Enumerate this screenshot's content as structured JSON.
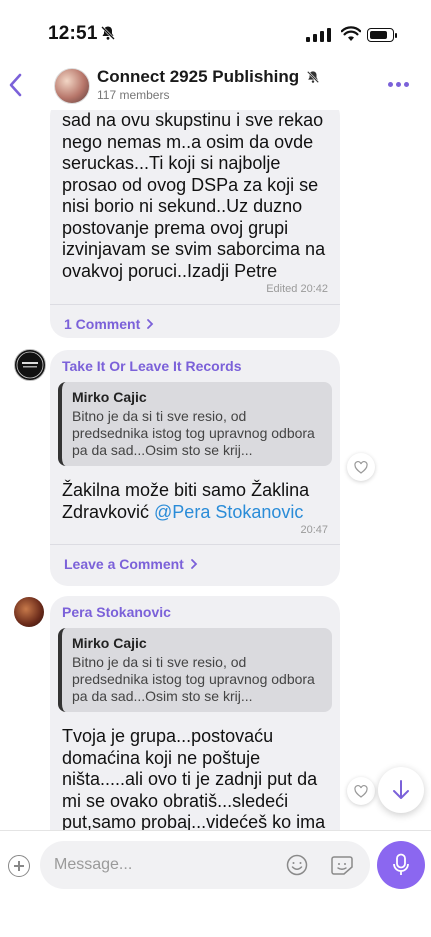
{
  "status_bar": {
    "time": "12:51"
  },
  "header": {
    "title": "Connect 2925 Publishing",
    "members": "117 members"
  },
  "messages": [
    {
      "text": "sad na ovu skupstinu i sve rekao nego nemas m..a osim da ovde seruckas...Ti koji si najbolje prosao od ovog DSPa za koji se nisi borio ni sekund..Uz duzno postovanje prema ovoj grupi izvinjavam se svim saborcima na ovakvoj poruci..Izadji Petre",
      "edited": "Edited",
      "time": "20:42",
      "comment_link": "1 Comment"
    },
    {
      "sender": "Take It Or Leave It Records",
      "quote_name": "Mirko Cajic",
      "quote_text": "Bitno je da si ti sve resio, od predsednika istog tog upravnog odbora pa da sad...Osim sto se krij...",
      "text_before": "Žakilna može biti samo Žaklina Zdravković ",
      "mention": "@Pera Stokanovic",
      "time": "20:47",
      "comment_link": "Leave a Comment"
    },
    {
      "sender": "Pera Stokanovic",
      "quote_name": "Mirko Cajic",
      "quote_text": "Bitno je da si ti sve resio, od predsednika istog tog upravnog odbora pa da sad...Osim sto se krij...",
      "text": "Tvoja je grupa...postovaću domaćina koji ne poštuje ništa.....ali ovo ti je zadnji put da mi se ovako obratiš...sledeći put,samo probaj...videćeš ko ima"
    }
  ],
  "input": {
    "placeholder": "Message..."
  },
  "colors": {
    "accent": "#7b61d9",
    "mention": "#2a8cd8",
    "mic": "#8b67f0"
  }
}
